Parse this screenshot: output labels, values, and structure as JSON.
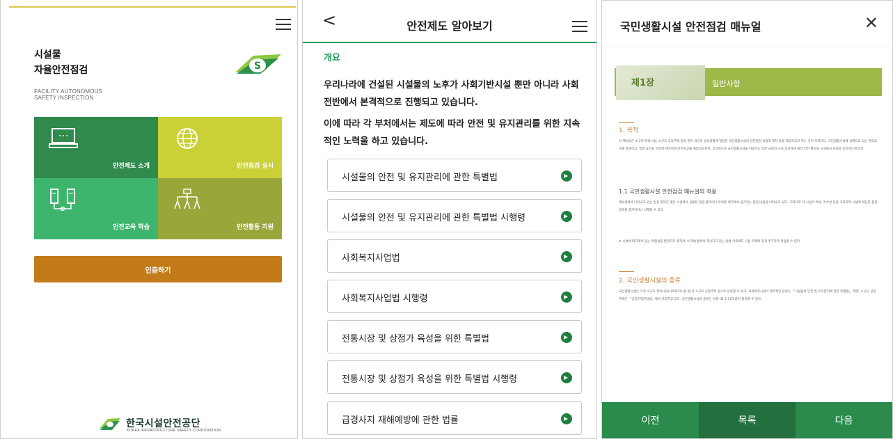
{
  "panel1": {
    "title_line1": "시설물",
    "title_line2": "자율안전점검",
    "subtitle_line1": "FACILITY AUTONOMOUS",
    "subtitle_line2": "SAFETY INSPECTION",
    "tiles": [
      {
        "label": "안전제도 소개",
        "icon": "computer-icon",
        "color": "#2f8a4c"
      },
      {
        "label": "안전점검 실시",
        "icon": "globe-icon",
        "color": "#c9d137"
      },
      {
        "label": "안전교육 학습",
        "icon": "network-icon",
        "color": "#3db56d"
      },
      {
        "label": "안전활동 지원",
        "icon": "org-chart-icon",
        "color": "#9aa63a"
      }
    ],
    "auth_button": "인증하기",
    "footer_name": "한국시설안전공단",
    "footer_sub": "KOREA INFRASTRUCTURE SAFETY CORPORATION"
  },
  "panel2": {
    "title": "안전제도 알아보기",
    "back_glyph": "<",
    "section": "개요",
    "para1": "우리나라에 건설된 시설물의 노후가 사회기반시설 뿐만 아니라 사회전반에서 본격적으로 진행되고 있습니다.",
    "para2": "이에 따라 각 부처에서는 제도에 따라 안전 및 유지관리를 위한 지속적인 노력을 하고 있습니다.",
    "laws": [
      "시설물의 안전 및 유지관리에 관한 특별법",
      "시설물의 안전 및 유지관리에 관한 특별법 시행령",
      "사회복지사업법",
      "사회복지사업법 시행령",
      "전통시장 및 상점가 육성을 위한 특별법",
      "전통시장 및 상점가 육성을 위한 특별법 시행령",
      "급경사지 재해예방에 관한 법률"
    ]
  },
  "panel3": {
    "title": "국민생활시설 안전점검 매뉴얼",
    "close_glyph": "✕",
    "doc": {
      "chapter": "제1장",
      "chapter_title": "일반사항",
      "section1": "1. 목적",
      "text1": "이 매뉴얼은 소규모 취약시설, 소규모 공동주택 등과 같이 국민의 일상생활에 밀접한 국민생활시설의 안전점검 방법과 절차 등을 제공하고자 하는 것이 목적이다. 국민생활시설에 설계되고 있는 취약요소를 발견하고, 적절 요인을 미연에 제거하여 안전사고를 예방함으로써, 궁극적으로 국민생활시설을 이용하는 일반 국민의 시설 중사자에 대한 안전 확보와 시설물의 효용을 증진하는데 있다.",
      "sub1": "1.1 국민생활시설 안전점검 매뉴얼의 적용",
      "text2": "매뉴얼에서 나타내고 있는 점검 항목은 많은 시설에서 공통된 점검 항목이나 유의할 세지에서 숨기려는 점검 내용을 나타내고 있다. 그러므로 각 시설의 특성, 특수성 등을 고려하여 시설에 적당한 점검 항목을 첨가하거나 삭제할 수 있다.",
      "text3": "※ 시설에 대하여서 있는 특행성을 발견하지 못해서, 이 매뉴얼에서 제시하고 있는 방법 이외에도 사용 목적에 맞게 추가하여 적용할 수 있다.",
      "section2": "2. 국민생활시설의 종류",
      "text4": "국민생활시설은 크게 소규모 취약시설(사회복지시설 등)과 소규모 공동주택 등으로 분류할 수 있고, 사회복지시설이 세부적인 분류는 「시설물의 안전 및 유지관리에 관한 특별법」 제정, 소규모 공동주택은 「공동주택관리법」에서 규정하고 있다. 국민생활시설의 종류는 아래 [표 1-1]과 같이 정리할 수 있다."
    },
    "footer": {
      "prev": "이전",
      "list": "목록",
      "next": "다음"
    }
  }
}
